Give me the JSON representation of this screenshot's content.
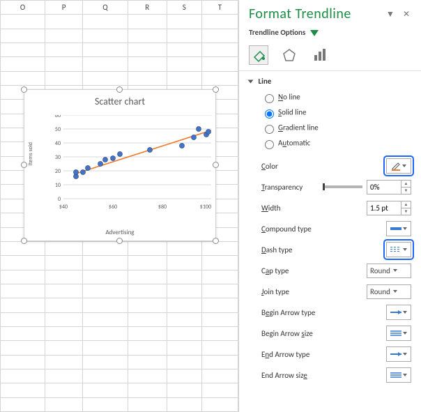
{
  "sheet": {
    "columns": [
      "O",
      "P",
      "Q",
      "R",
      "S",
      "T"
    ]
  },
  "chart_data": {
    "type": "scatter",
    "title": "Scatter chart",
    "xlabel": "Advertising",
    "ylabel": "Items sold",
    "xlim": [
      40,
      100
    ],
    "ylim": [
      0,
      60
    ],
    "yticks": [
      0,
      10,
      20,
      30,
      40,
      50,
      60
    ],
    "xticks_labels": [
      "$40",
      "$60",
      "$80",
      "$100"
    ],
    "xticks": [
      40,
      60,
      80,
      100
    ],
    "trend": {
      "x": [
        45,
        100
      ],
      "y": [
        18,
        49
      ],
      "color": "#ed7d31"
    },
    "series": [
      {
        "name": "Items sold",
        "color": "#4472c4",
        "points": [
          {
            "x": 45,
            "y": 16
          },
          {
            "x": 45,
            "y": 19
          },
          {
            "x": 48,
            "y": 19
          },
          {
            "x": 50,
            "y": 22
          },
          {
            "x": 55,
            "y": 25
          },
          {
            "x": 57,
            "y": 28
          },
          {
            "x": 60,
            "y": 29
          },
          {
            "x": 63,
            "y": 32
          },
          {
            "x": 75,
            "y": 35
          },
          {
            "x": 88,
            "y": 38
          },
          {
            "x": 93,
            "y": 44
          },
          {
            "x": 95,
            "y": 50
          },
          {
            "x": 98,
            "y": 46
          },
          {
            "x": 99,
            "y": 48
          }
        ]
      }
    ]
  },
  "pane": {
    "title": "Format Trendline",
    "subheader": "Trendline Options",
    "section": "Line",
    "radios": {
      "no_line": "No line",
      "solid": "Solid line",
      "gradient": "Gradient line",
      "automatic": "Automatic",
      "selected": "solid"
    },
    "props": {
      "color": "Color",
      "transparency": "Transparency",
      "transparency_val": "0%",
      "width": "Width",
      "width_val": "1.5 pt",
      "compound": "Compound type",
      "dash": "Dash type",
      "cap": "Cap type",
      "cap_val": "Round",
      "join": "Join type",
      "join_val": "Round",
      "b_arr_t": "Begin Arrow type",
      "b_arr_s": "Begin Arrow size",
      "e_arr_t": "End Arrow type",
      "e_arr_s": "End Arrow size"
    }
  }
}
